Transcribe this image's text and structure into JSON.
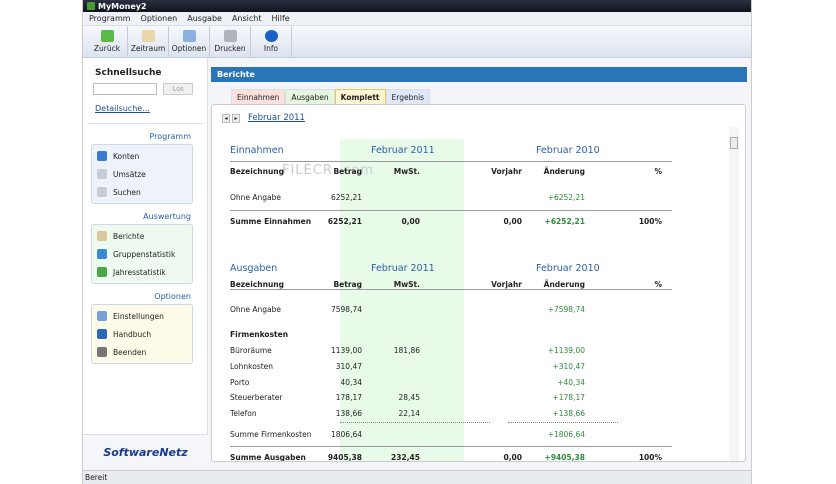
{
  "window": {
    "title": "MyMoney2"
  },
  "menu": [
    "Programm",
    "Optionen",
    "Ausgabe",
    "Ansicht",
    "Hilfe"
  ],
  "toolbar": [
    {
      "label": "Zurück",
      "icon": "back-arrow-icon",
      "color": "#5cb84a"
    },
    {
      "label": "Zeitraum",
      "icon": "calendar-icon",
      "color": "#e8d8a8"
    },
    {
      "label": "Optionen",
      "icon": "options-window-icon",
      "color": "#8ab0e0"
    },
    {
      "label": "Drucken",
      "icon": "printer-icon",
      "color": "#b0b4bc"
    },
    {
      "label": "Info",
      "icon": "info-icon",
      "color": "#1a60c8"
    }
  ],
  "sidebar": {
    "search_title": "Schnellsuche",
    "search_value": "",
    "search_button": "Los",
    "detail_link": "Detailsuche...",
    "groups": [
      {
        "title": "Programm",
        "bg": "#eef3fb",
        "items": [
          {
            "label": "Konten",
            "icon": "globe-icon",
            "color": "#3a7ad0"
          },
          {
            "label": "Umsätze",
            "icon": "document-icon",
            "color": "#c8ccd4"
          },
          {
            "label": "Suchen",
            "icon": "search-document-icon",
            "color": "#c8ccd4"
          }
        ]
      },
      {
        "title": "Auswertung",
        "bg": "#eefaf0",
        "items": [
          {
            "label": "Berichte",
            "icon": "report-icon",
            "color": "#d8c8a0"
          },
          {
            "label": "Gruppenstatistik",
            "icon": "pie-chart-icon",
            "color": "#3a8ad0"
          },
          {
            "label": "Jahresstatistik",
            "icon": "bar-chart-icon",
            "color": "#4aa84a"
          }
        ]
      },
      {
        "title": "Optionen",
        "bg": "#fefbe8",
        "items": [
          {
            "label": "Einstellungen",
            "icon": "settings-window-icon",
            "color": "#7aa0d8"
          },
          {
            "label": "Handbuch",
            "icon": "book-icon",
            "color": "#2a6ab8"
          },
          {
            "label": "Beenden",
            "icon": "exit-icon",
            "color": "#777"
          }
        ]
      }
    ],
    "logo": "SoftwareNetz"
  },
  "main": {
    "header": "Berichte",
    "tabs": [
      {
        "label": "Einnahmen",
        "bg": "#fbe0de",
        "active": false
      },
      {
        "label": "Ausgaben",
        "bg": "#e4f6e0",
        "active": false
      },
      {
        "label": "Komplett",
        "bg": "#fdf6d0",
        "active": true
      },
      {
        "label": "Ergebnis",
        "bg": "#dfe8f8",
        "active": false
      }
    ],
    "period": "Februar 2011",
    "watermark": "FILECR .com",
    "sections": [
      {
        "title": "Einnahmen",
        "period_current": "Februar 2011",
        "period_previous": "Februar 2010",
        "columns": [
          "Bezeichnung",
          "Betrag",
          "MwSt.",
          "Vorjahr",
          "Änderung",
          "%"
        ],
        "rows": [
          {
            "type": "item",
            "cells": [
              "Ohne Angabe",
              "6252,21",
              "",
              "",
              "+6252,21",
              ""
            ]
          },
          {
            "type": "sum",
            "cells": [
              "Summe Einnahmen",
              "6252,21",
              "0,00",
              "0,00",
              "+6252,21",
              "100%"
            ]
          }
        ]
      },
      {
        "title": "Ausgaben",
        "period_current": "Februar 2011",
        "period_previous": "Februar 2010",
        "columns": [
          "Bezeichnung",
          "Betrag",
          "MwSt.",
          "Vorjahr",
          "Änderung",
          "%"
        ],
        "rows": [
          {
            "type": "item",
            "cells": [
              "Ohne Angabe",
              "7598,74",
              "",
              "",
              "+7598,74",
              ""
            ]
          },
          {
            "type": "group",
            "cells": [
              "Firmenkosten",
              "",
              "",
              "",
              "",
              ""
            ]
          },
          {
            "type": "item",
            "cells": [
              "Büroräume",
              "1139,00",
              "181,86",
              "",
              "+1139,00",
              ""
            ]
          },
          {
            "type": "item",
            "cells": [
              "Lohnkosten",
              "310,47",
              "",
              "",
              "+310,47",
              ""
            ]
          },
          {
            "type": "item",
            "cells": [
              "Porto",
              "40,34",
              "",
              "",
              "+40,34",
              ""
            ]
          },
          {
            "type": "item",
            "cells": [
              "Steuerberater",
              "178,17",
              "28,45",
              "",
              "+178,17",
              ""
            ]
          },
          {
            "type": "item",
            "cells": [
              "Telefon",
              "138,66",
              "22,14",
              "",
              "+138,66",
              ""
            ]
          },
          {
            "type": "subsum",
            "cells": [
              "Summe Firmenkosten",
              "1806,64",
              "",
              "",
              "+1806,64",
              ""
            ]
          },
          {
            "type": "sum",
            "cells": [
              "Summe Ausgaben",
              "9405,38",
              "232,45",
              "0,00",
              "+9405,38",
              "100%"
            ]
          }
        ]
      }
    ]
  },
  "status": "Bereit"
}
